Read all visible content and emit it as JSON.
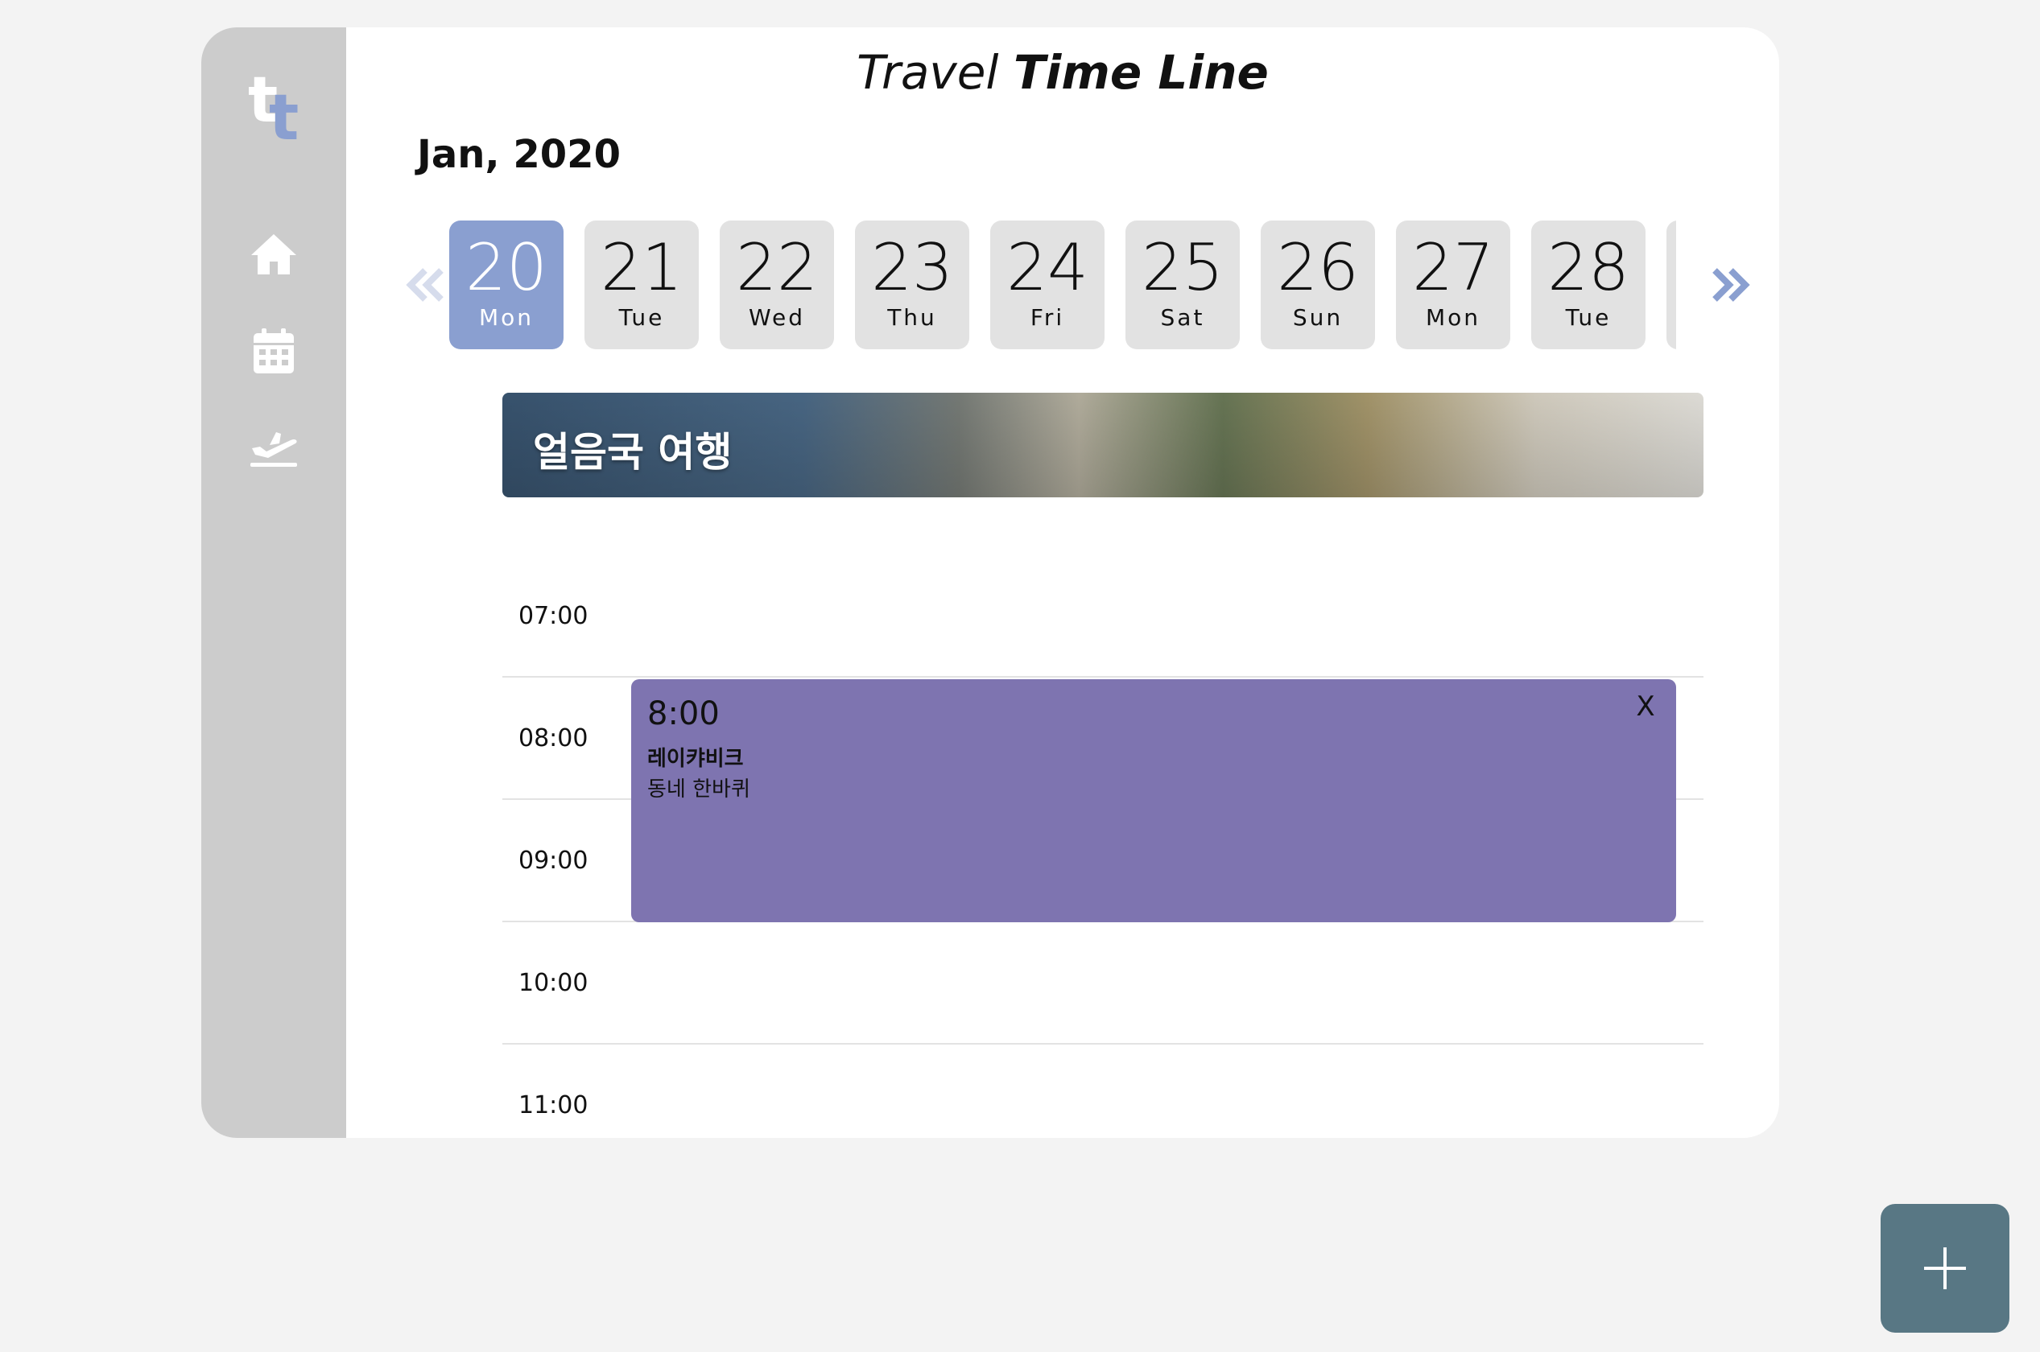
{
  "app_title": {
    "part1": "Travel",
    "part2": "Time Line"
  },
  "logo": {
    "letter1": "t",
    "letter2": "t"
  },
  "sidebar": {
    "items": [
      {
        "icon": "home-icon"
      },
      {
        "icon": "calendar-icon"
      },
      {
        "icon": "flight-icon"
      }
    ]
  },
  "month_label": "Jan, 2020",
  "date_strip": {
    "prev_icon": "double-chevron-left-icon",
    "next_icon": "double-chevron-right-icon",
    "days": [
      {
        "num": "20",
        "dow": "Mon",
        "selected": true
      },
      {
        "num": "21",
        "dow": "Tue"
      },
      {
        "num": "22",
        "dow": "Wed"
      },
      {
        "num": "23",
        "dow": "Thu"
      },
      {
        "num": "24",
        "dow": "Fri"
      },
      {
        "num": "25",
        "dow": "Sat"
      },
      {
        "num": "26",
        "dow": "Sun"
      },
      {
        "num": "27",
        "dow": "Mon"
      },
      {
        "num": "28",
        "dow": "Tue"
      }
    ]
  },
  "trip_banner": {
    "title": "얼음국 여행"
  },
  "timeline": {
    "hours": [
      "07:00",
      "08:00",
      "09:00",
      "10:00",
      "11:00"
    ]
  },
  "event": {
    "time": "8:00",
    "place": "레이캬비크",
    "description": "동네 한바퀴",
    "close_label": "X"
  },
  "fab": {
    "icon": "plus-icon"
  },
  "colors": {
    "accent": "#8a9fd0",
    "event": "#7e74b0",
    "fab": "#587784",
    "sidebar": "#cccccc"
  }
}
